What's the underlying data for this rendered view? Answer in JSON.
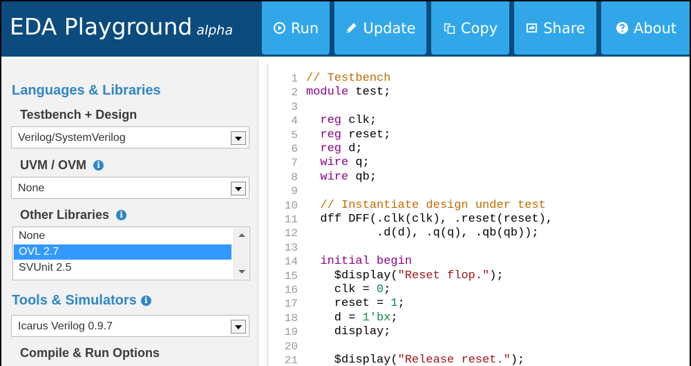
{
  "header": {
    "title": "EDA Playground",
    "tag": "alpha",
    "buttons": [
      {
        "label": "Run",
        "icon": "play-circle-icon"
      },
      {
        "label": "Update",
        "icon": "pencil-icon"
      },
      {
        "label": "Copy",
        "icon": "copy-icon"
      },
      {
        "label": "Share",
        "icon": "share-icon"
      },
      {
        "label": "About",
        "icon": "question-circle-icon"
      }
    ],
    "colors": {
      "bar": "#0b4b7e",
      "button": "#31a7ea"
    }
  },
  "sidebar": {
    "languages_title": "Languages & Libraries",
    "testbench_label": "Testbench + Design",
    "testbench_value": "Verilog/SystemVerilog",
    "uvm_label": "UVM / OVM",
    "uvm_value": "None",
    "libs_label": "Other Libraries",
    "libs_options": [
      "None",
      "OVL 2.7",
      "SVUnit 2.5"
    ],
    "libs_selected": "OVL 2.7",
    "tools_title": "Tools & Simulators",
    "tools_value": "Icarus Verilog 0.9.7",
    "compile_label": "Compile & Run Options",
    "info_glyph": "i"
  },
  "editor": {
    "line_numbers": [
      "1",
      "2",
      "3",
      "4",
      "5",
      "6",
      "7",
      "8",
      "9",
      "10",
      "11",
      "12",
      "13",
      "14",
      "15",
      "16",
      "17",
      "18",
      "19",
      "20",
      "21"
    ],
    "lines": [
      [
        {
          "t": "// Testbench",
          "c": "cm"
        }
      ],
      [
        {
          "t": "module",
          "c": "kw"
        },
        {
          "t": " test;",
          "c": ""
        }
      ],
      [],
      [
        {
          "t": "  ",
          "c": ""
        },
        {
          "t": "reg",
          "c": "kw"
        },
        {
          "t": " clk;",
          "c": ""
        }
      ],
      [
        {
          "t": "  ",
          "c": ""
        },
        {
          "t": "reg",
          "c": "kw"
        },
        {
          "t": " reset;",
          "c": ""
        }
      ],
      [
        {
          "t": "  ",
          "c": ""
        },
        {
          "t": "reg",
          "c": "kw"
        },
        {
          "t": " d;",
          "c": ""
        }
      ],
      [
        {
          "t": "  ",
          "c": ""
        },
        {
          "t": "wire",
          "c": "kw"
        },
        {
          "t": " q;",
          "c": ""
        }
      ],
      [
        {
          "t": "  ",
          "c": ""
        },
        {
          "t": "wire",
          "c": "kw"
        },
        {
          "t": " qb;",
          "c": ""
        }
      ],
      [],
      [
        {
          "t": "  // Instantiate design under test",
          "c": "cm"
        }
      ],
      [
        {
          "t": "  dff DFF(.clk(clk), .reset(reset),",
          "c": ""
        }
      ],
      [
        {
          "t": "          .d(d), .q(q), .qb(qb));",
          "c": ""
        }
      ],
      [],
      [
        {
          "t": "  ",
          "c": ""
        },
        {
          "t": "initial begin",
          "c": "kw"
        }
      ],
      [
        {
          "t": "    $display(",
          "c": ""
        },
        {
          "t": "\"Reset flop.\"",
          "c": "st"
        },
        {
          "t": ");",
          "c": ""
        }
      ],
      [
        {
          "t": "    clk = ",
          "c": ""
        },
        {
          "t": "0",
          "c": "nm"
        },
        {
          "t": ";",
          "c": ""
        }
      ],
      [
        {
          "t": "    reset = ",
          "c": ""
        },
        {
          "t": "1",
          "c": "nm"
        },
        {
          "t": ";",
          "c": ""
        }
      ],
      [
        {
          "t": "    d = ",
          "c": ""
        },
        {
          "t": "1'bx",
          "c": "nm"
        },
        {
          "t": ";",
          "c": ""
        }
      ],
      [
        {
          "t": "    display;",
          "c": ""
        }
      ],
      [],
      [
        {
          "t": "    $display(",
          "c": ""
        },
        {
          "t": "\"Release reset.\"",
          "c": "st"
        },
        {
          "t": ");",
          "c": ""
        }
      ]
    ]
  }
}
